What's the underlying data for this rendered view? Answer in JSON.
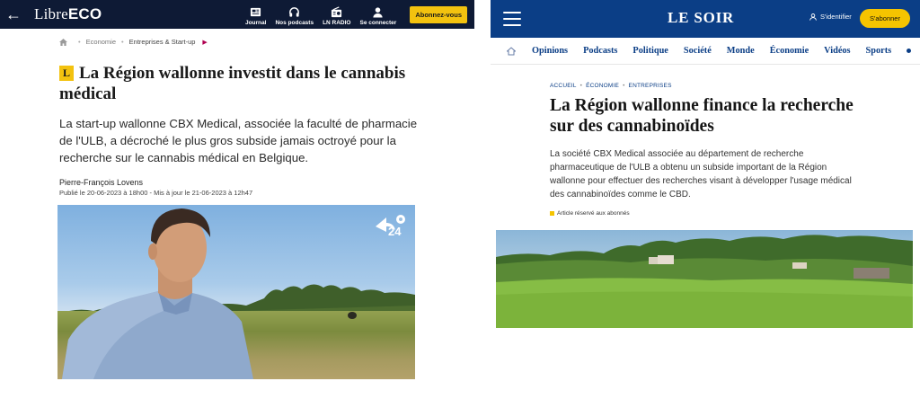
{
  "libre": {
    "logo_prefix": "Libre",
    "logo_suffix": "ECO",
    "nav": [
      {
        "icon": "newspaper-icon",
        "label": "Journal"
      },
      {
        "icon": "headphones-icon",
        "label": "Nos podcasts"
      },
      {
        "icon": "radio-icon",
        "label": "LN RADIO"
      },
      {
        "icon": "user-icon",
        "label": "Se connecter"
      }
    ],
    "subscribe": "Abonnez-vous",
    "breadcrumb": [
      "Economie",
      "Entreprises & Start-up"
    ],
    "badge": "L",
    "title": "La Région wallonne investit dans le cannabis médical",
    "lead": "La start-up wallonne CBX Medical, associée la faculté de pharmacie de l'ULB, a décroché le plus gros subside jamais octroyé pour la recherche sur le cannabis médical en Belgique.",
    "author": "Pierre-François Lovens",
    "date": "Publié le 20-06-2023 à 18h00 - Mis à jour le 21-06-2023 à 12h47",
    "video_logo": "24",
    "accent": "#f3c20f",
    "brand": "#0e1a35"
  },
  "soir": {
    "logo": "LE SOIR",
    "login": "S'identifier",
    "subscribe": "S'abonner",
    "nav": [
      "Opinions",
      "Podcasts",
      "Politique",
      "Société",
      "Monde",
      "Économie",
      "Vidéos",
      "Sports"
    ],
    "breadcrumb": [
      "ACCUEIL",
      "ÉCONOMIE",
      "ENTREPRISES"
    ],
    "title": "La Région wallonne finance la recherche sur des cannabinoïdes",
    "lead": "La société CBX Medical associée au département de recherche pharmaceutique de l'ULB a obtenu un subside important de la Région wallonne pour effectuer des recherches visant à développer l'usage médical des cannabinoïdes comme le CBD.",
    "reserved": "Article réservé aux abonnés",
    "brand": "#0b3e86",
    "accent": "#f5c400"
  }
}
